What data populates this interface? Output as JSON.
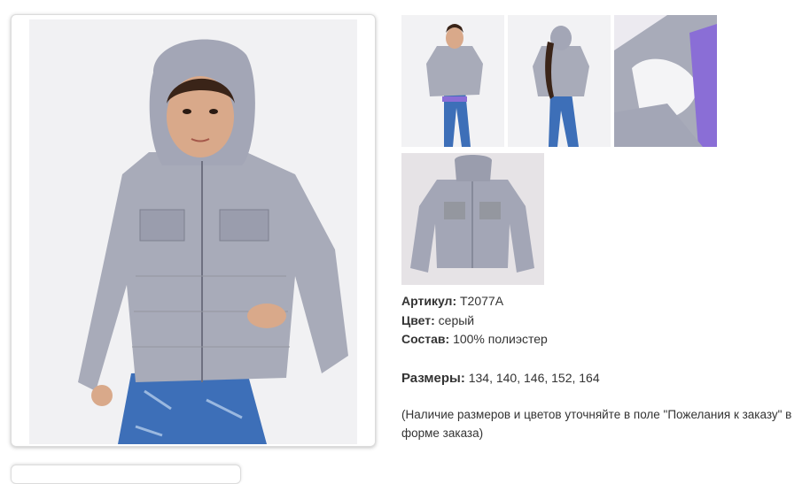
{
  "product": {
    "article_label": "Артикул:",
    "article_value": "T2077A",
    "color_label": "Цвет:",
    "color_value": "серый",
    "composition_label": "Состав:",
    "composition_value": "100% полиэстер",
    "sizes_label": "Размеры:",
    "sizes_value": "134, 140, 146, 152, 164",
    "note": "(Наличие размеров и цветов уточняйте в поле \"Пожелания к заказу\" в форме заказа)"
  },
  "colors": {
    "jacket": "#a8abb9",
    "jacket_dark": "#8a8d9c",
    "jeans": "#3d6fb8",
    "hair": "#3a2418",
    "skin": "#d9a98a",
    "background": "#f2f2f4",
    "lining_purple": "#8a6ed6"
  },
  "images": {
    "main": "girl-in-gray-hooded-quilted-jacket",
    "thumbnails": [
      "front-view",
      "back-view",
      "inner-lining-detail",
      "jacket-flat-lay"
    ]
  }
}
